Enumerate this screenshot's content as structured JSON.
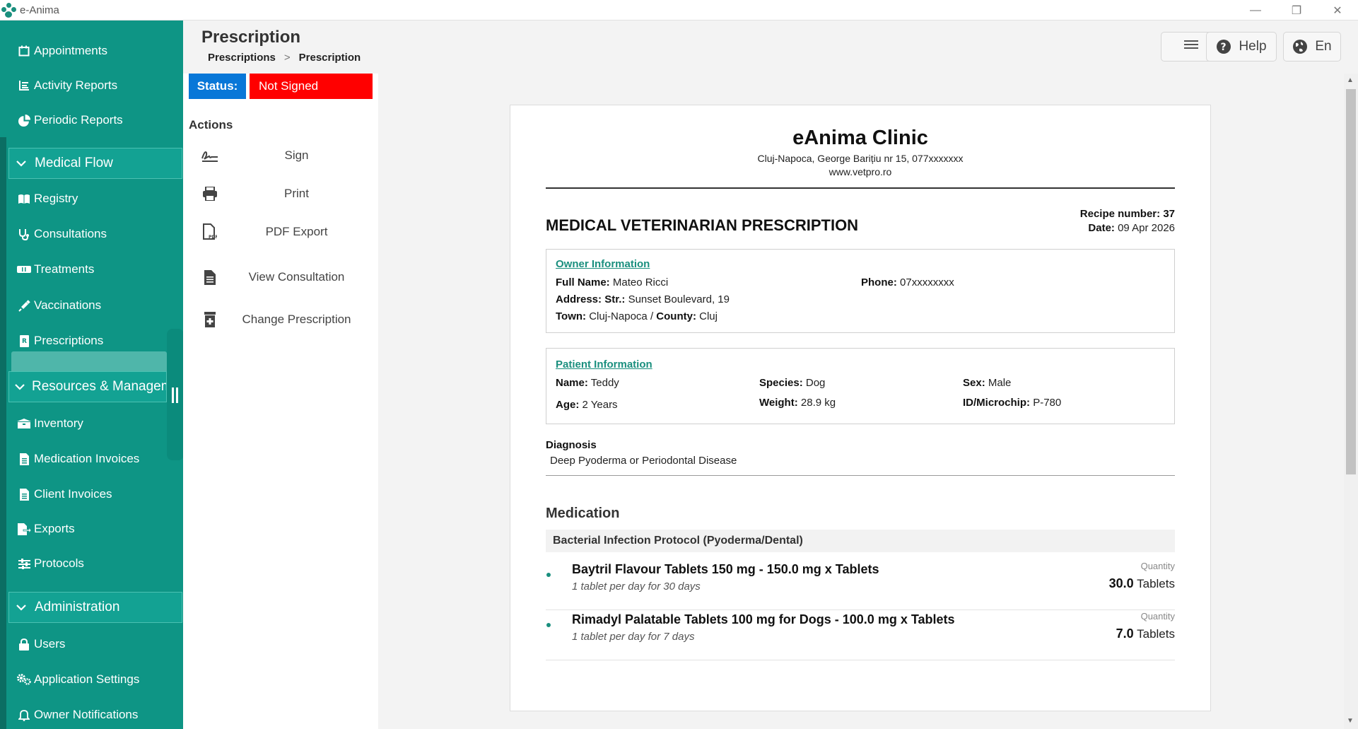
{
  "window": {
    "title": "e-Anima"
  },
  "sidebar": {
    "items_top": [
      {
        "label": "Appointments",
        "icon": "calendar-icon"
      },
      {
        "label": "Activity Reports",
        "icon": "list-icon"
      },
      {
        "label": "Periodic Reports",
        "icon": "pie-chart-icon"
      }
    ],
    "section_medical": "Medical Flow",
    "items_medical": [
      {
        "label": "Registry",
        "icon": "book-icon"
      },
      {
        "label": "Consultations",
        "icon": "stethoscope-icon"
      },
      {
        "label": "Treatments",
        "icon": "bandage-icon"
      },
      {
        "label": "Vaccinations",
        "icon": "syringe-icon"
      },
      {
        "label": "Prescriptions",
        "icon": "prescription-icon"
      }
    ],
    "section_resources": "Resources & Managem",
    "items_resources": [
      {
        "label": "Inventory",
        "icon": "boxes-icon"
      },
      {
        "label": "Medication Invoices",
        "icon": "file-icon"
      },
      {
        "label": "Client Invoices",
        "icon": "file-icon"
      },
      {
        "label": "Exports",
        "icon": "export-icon"
      },
      {
        "label": "Protocols",
        "icon": "sliders-icon"
      }
    ],
    "section_admin": "Administration",
    "items_admin": [
      {
        "label": "Users",
        "icon": "lock-icon"
      },
      {
        "label": "Application Settings",
        "icon": "gears-icon"
      },
      {
        "label": "Owner Notifications",
        "icon": "bell-icon"
      }
    ]
  },
  "header": {
    "title": "Prescription",
    "breadcrumb": [
      "Prescriptions",
      ">",
      "Prescription"
    ],
    "help_label": "Help",
    "lang_label": "En"
  },
  "status": {
    "label": "Status:",
    "value": "Not Signed"
  },
  "actions": {
    "title": "Actions",
    "items": [
      {
        "label": "Sign",
        "icon": "signature-icon"
      },
      {
        "label": "Print",
        "icon": "print-icon"
      },
      {
        "label": "PDF Export",
        "icon": "pdf-icon"
      },
      {
        "label": "View Consultation",
        "icon": "document-icon"
      },
      {
        "label": "Change Prescription",
        "icon": "prescription-bottle-icon"
      }
    ]
  },
  "document": {
    "clinic_name": "eAnima Clinic",
    "clinic_address": "Cluj-Napoca, George Barițiu nr 15, 077xxxxxxx",
    "clinic_website": "www.vetpro.ro",
    "title": "MEDICAL VETERINARIAN PRESCRIPTION",
    "recipe_label": "Recipe number:",
    "recipe_number": "37",
    "date_label": "Date:",
    "date": "09 Apr 2026",
    "owner": {
      "title": "Owner Information",
      "full_name_label": "Full Name:",
      "full_name": "Mateo Ricci",
      "phone_label": "Phone:",
      "phone": "07xxxxxxxx",
      "address_label": "Address:",
      "address_str_label": "Str.:",
      "address": "Sunset Boulevard, 19",
      "town_label": "Town:",
      "town": "Cluj-Napoca",
      "county_sep": "/",
      "county_label": "County:",
      "county": "Cluj"
    },
    "patient": {
      "title": "Patient Information",
      "name_label": "Name:",
      "name": "Teddy",
      "species_label": "Species:",
      "species": "Dog",
      "sex_label": "Sex:",
      "sex": "Male",
      "age_label": "Age:",
      "age": "2 Years",
      "weight_label": "Weight:",
      "weight": "28.9 kg",
      "id_label": "ID/Microchip:",
      "id": "P-780"
    },
    "diagnosis_title": "Diagnosis",
    "diagnosis": "Deep Pyoderma or Periodontal Disease",
    "medication_title": "Medication",
    "protocol": "Bacterial Infection Protocol (Pyoderma/Dental)",
    "medications": [
      {
        "name": "Baytril Flavour Tablets 150 mg - 150.0 mg x Tablets",
        "dosage": "1 tablet per day for 30 days",
        "quantity_label": "Quantity",
        "quantity": "30.0",
        "unit": "Tablets"
      },
      {
        "name": "Rimadyl Palatable Tablets 100 mg for Dogs - 100.0 mg x Tablets",
        "dosage": "1 tablet per day for 7 days",
        "quantity_label": "Quantity",
        "quantity": "7.0",
        "unit": "Tablets"
      }
    ]
  },
  "colors": {
    "sidebar": "#0e9585",
    "accent": "#1a8f7e",
    "status_label": "#0877d8",
    "status_not_signed": "#ff0000"
  }
}
